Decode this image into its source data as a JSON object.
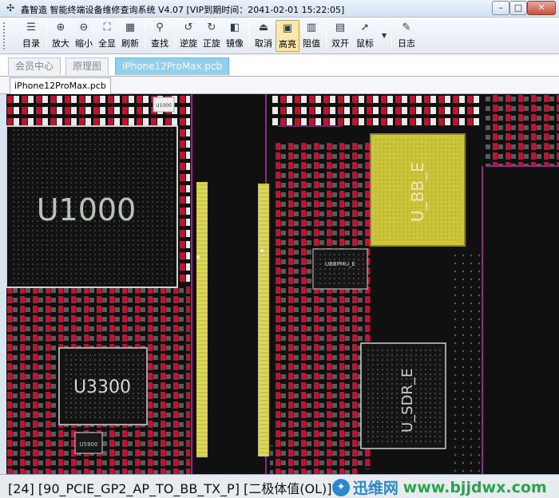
{
  "window": {
    "icon": "chip-icon",
    "title": "鑫智造 智能终端设备维修查询系统 V4.07 [VIP到期时间：2041-02-01 15:22:05]",
    "min_glyph": "–",
    "max_glyph": "□",
    "close_glyph": "✕"
  },
  "toolbar": {
    "catalog": "目录",
    "zoom_in": "放大",
    "zoom_out": "缩小",
    "fit_all": "全显",
    "refresh": "刷新",
    "find": "查找",
    "rotate_ccw": "逆旋",
    "rotate_cw": "正旋",
    "mirror": "镜像",
    "cancel": "取消",
    "highlight": "高亮",
    "resistance": "阻值",
    "dual_open": "双开",
    "mouse": "鼠标",
    "log": "日志"
  },
  "tabs": {
    "member": "会员中心",
    "schematic": "原理图",
    "pcb": "iPhone12ProMax.pcb"
  },
  "doc_tab": "iPhone12ProMax.pcb",
  "board": {
    "labels": {
      "u1000": "U1000",
      "u3300": "U3300",
      "ubbe": "U_BB_E",
      "usdre": "U_SDR_E",
      "bbpmu": "UBBPMU_E",
      "u1000_small": "U1000",
      "u5900": "U5900"
    },
    "colors": {
      "pad_red": "#c8102e",
      "highlight": "#d8d22a",
      "trace_purple": "#8a2d8a",
      "text_gray": "#b8c4b8"
    }
  },
  "status": {
    "text": "[24] [90_PCIE_GP2_AP_TO_BB_TX_P] [二极体值(OL)]",
    "watermark_cn": "迅维网",
    "watermark_url": "www.bjjdwx.com"
  }
}
